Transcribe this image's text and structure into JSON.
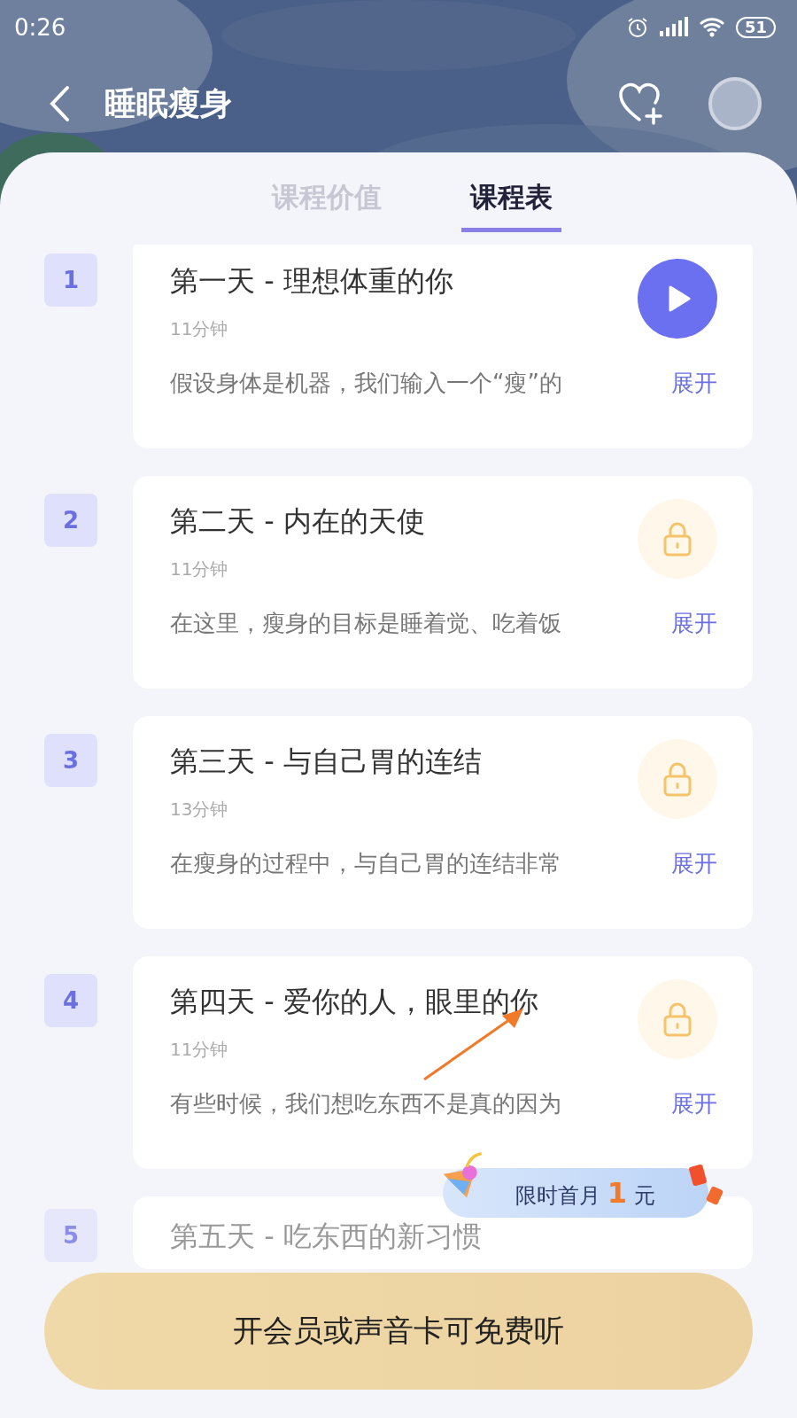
{
  "status_bar": {
    "time": "0:26",
    "battery": "51"
  },
  "nav": {
    "title": "睡眠瘦身"
  },
  "tabs": [
    {
      "label": "课程价值",
      "selected": false
    },
    {
      "label": "课程表",
      "selected": true
    }
  ],
  "lessons": [
    {
      "number": "1",
      "title": "第一天 - 理想体重的你",
      "duration": "11分钟",
      "description": "假设身体是机器，我们输入一个“瘦”的",
      "expand": "展开",
      "kind": "play"
    },
    {
      "number": "2",
      "title": "第二天 - 内在的天使",
      "duration": "11分钟",
      "description": "在这里，瘦身的目标是睡着觉、吃着饭",
      "expand": "展开",
      "kind": "locked"
    },
    {
      "number": "3",
      "title": "第三天 - 与自己胃的连结",
      "duration": "13分钟",
      "description": "在瘦身的过程中，与自己胃的连结非常",
      "expand": "展开",
      "kind": "locked"
    },
    {
      "number": "4",
      "title": "第四天 - 爱你的人，眼里的你",
      "duration": "11分钟",
      "description": "有些时候，我们想吃东西不是真的因为",
      "expand": "展开",
      "kind": "locked"
    },
    {
      "number": "5",
      "title": "第五天 - 吃东西的新习惯"
    }
  ],
  "promo": {
    "text": "限时首月",
    "highlight": "1",
    "unit": "元"
  },
  "cta": {
    "label": "开会员或声音卡可免费听"
  }
}
